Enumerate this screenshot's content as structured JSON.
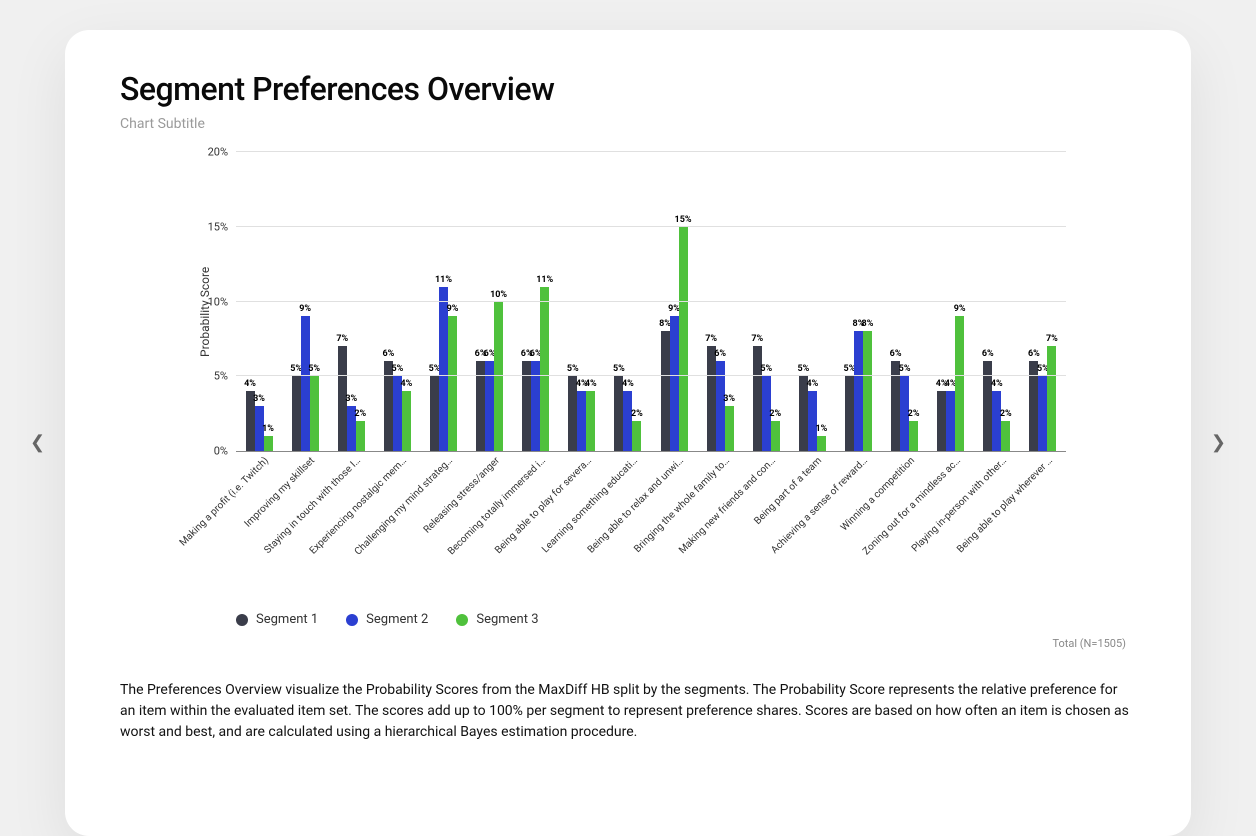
{
  "title": "Segment Preferences Overview",
  "subtitle": "Chart Subtitle",
  "ylabel": "Probability Score",
  "total_label": "Total (N=1505)",
  "description": "The Preferences Overview visualize the Probability Scores from the MaxDiff HB split by the segments. The Probability Score represents the relative preference for an item within the evaluated item set. The scores add up to 100% per segment to represent preference shares. Scores are based on how often an item is chosen as worst and best, and are calculated using a hierarchical Bayes estimation procedure.",
  "legend": [
    {
      "name": "Segment 1",
      "color": "#3a3d4a"
    },
    {
      "name": "Segment 2",
      "color": "#2b3fd1"
    },
    {
      "name": "Segment 3",
      "color": "#4fc13c"
    }
  ],
  "yticks": [
    0,
    5,
    10,
    15,
    20
  ],
  "chart_data": {
    "type": "bar",
    "ylabel": "Probability Score",
    "ylim": [
      0,
      20
    ],
    "unit": "%",
    "categories": [
      "Making a profit (i.e. Twitch)",
      "Improving my skillset",
      "Staying in touch with those I…",
      "Experiencing nostalgic mem…",
      "Challenging my mind strateg…",
      "Releasing stress/anger",
      "Becoming totally immersed i…",
      "Being able to play for severa…",
      "Learning something educati…",
      "Being able to relax and unwi…",
      "Bringing the whole family to…",
      "Making new friends and con…",
      "Being part of a team",
      "Achieving a sense of reward…",
      "Winning a competition",
      "Zoning out for a mindless ac…",
      "Playing in-person with other…",
      "Being able to play wherever …"
    ],
    "series": [
      {
        "name": "Segment 1",
        "color": "#3a3d4a",
        "values": [
          4,
          5,
          7,
          6,
          5,
          6,
          6,
          5,
          5,
          8,
          7,
          7,
          5,
          5,
          6,
          4,
          6,
          6
        ]
      },
      {
        "name": "Segment 2",
        "color": "#2b3fd1",
        "values": [
          3,
          9,
          3,
          5,
          11,
          6,
          6,
          4,
          4,
          9,
          6,
          5,
          4,
          8,
          5,
          4,
          4,
          5
        ]
      },
      {
        "name": "Segment 3",
        "color": "#4fc13c",
        "values": [
          1,
          5,
          2,
          4,
          9,
          10,
          11,
          4,
          2,
          15,
          3,
          2,
          1,
          8,
          2,
          9,
          2,
          7
        ]
      }
    ]
  }
}
